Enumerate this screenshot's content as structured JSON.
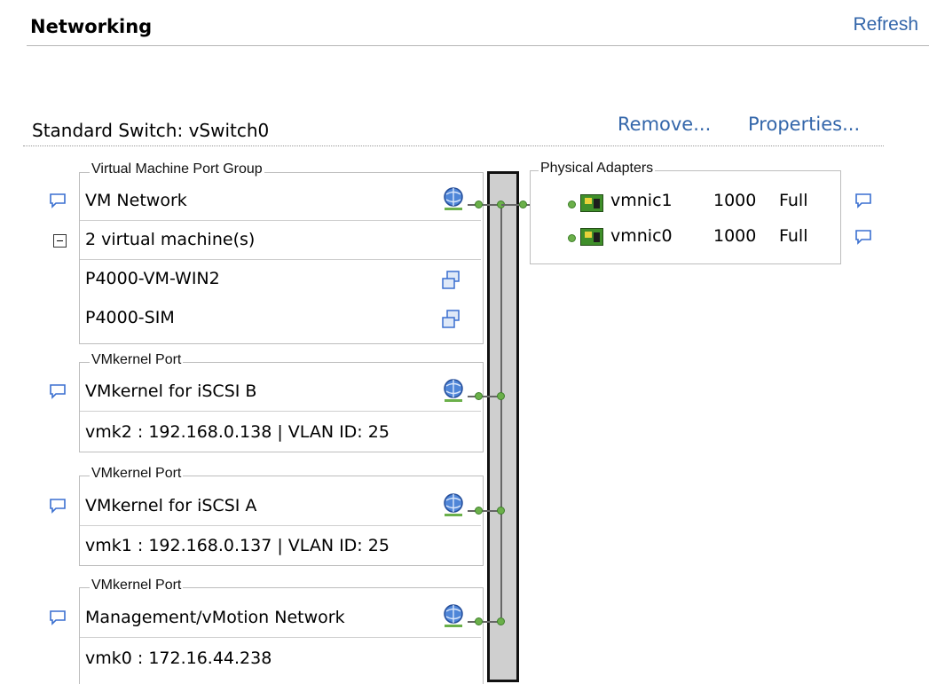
{
  "header": {
    "title": "Networking",
    "refresh": "Refresh"
  },
  "switch": {
    "label": "Standard Switch: vSwitch0",
    "remove": "Remove...",
    "properties": "Properties..."
  },
  "vm_group": {
    "legend": "Virtual Machine Port Group",
    "name": "VM Network",
    "vm_count": "2 virtual machine(s)",
    "vms": [
      "P4000-VM-WIN2",
      "P4000-SIM"
    ]
  },
  "vmk_b": {
    "legend": "VMkernel Port",
    "name": "VMkernel for iSCSI B",
    "detail": "vmk2 : 192.168.0.138 | VLAN ID: 25"
  },
  "vmk_a": {
    "legend": "VMkernel Port",
    "name": "VMkernel for iSCSI A",
    "detail": "vmk1 : 192.168.0.137 | VLAN ID: 25"
  },
  "vmk_mgmt": {
    "legend": "VMkernel Port",
    "name": "Management/vMotion Network",
    "detail": "vmk0 : 172.16.44.238"
  },
  "physical": {
    "legend": "Physical Adapters",
    "adapters": [
      {
        "name": "vmnic1",
        "speed": "1000",
        "duplex": "Full"
      },
      {
        "name": "vmnic0",
        "speed": "1000",
        "duplex": "Full"
      }
    ]
  },
  "icons": {
    "comment": "comment-icon",
    "network": "network-globe-icon",
    "vm": "vm-icon",
    "nic": "nic-icon",
    "collapse": "collapse-icon"
  },
  "colors": {
    "link": "#3366aa",
    "port_dot": "#6bb04a",
    "switch_fill": "#cfcfcf"
  }
}
